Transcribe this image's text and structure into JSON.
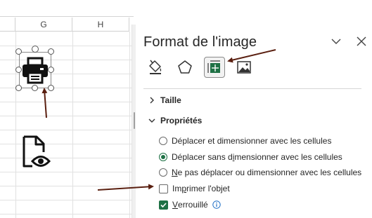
{
  "sheet": {
    "columns": [
      "G",
      "H"
    ],
    "icons": [
      "printer-icon",
      "document-preview-icon"
    ]
  },
  "pane": {
    "title": "Format de l'image",
    "tabs": [
      {
        "icon": "fill-line-icon",
        "active": false
      },
      {
        "icon": "effects-pentagon-icon",
        "active": false
      },
      {
        "icon": "size-properties-icon",
        "active": true
      },
      {
        "icon": "picture-icon",
        "active": false
      }
    ],
    "sections": {
      "size": "Taille",
      "properties": "Propriétés"
    },
    "object_positioning": {
      "move_and_size_pre": "Déplacer et dimensionner avec les cellules",
      "move_no_size_pre": "Déplacer sans d",
      "move_no_size_u": "i",
      "move_no_size_post": "mensionner avec les cellules",
      "dont_move_u": "N",
      "dont_move_post": "e pas déplacer ou dimensionner avec les cellules",
      "selected": "move_no_size"
    },
    "print_object_pre": "Im",
    "print_object_u": "p",
    "print_object_post": "rimer l'objet",
    "print_object_checked": false,
    "locked_u": "V",
    "locked_post": "errouillé",
    "locked_checked": true
  },
  "colors": {
    "accent_green": "#1e7145",
    "arrow": "#5a1f10"
  }
}
